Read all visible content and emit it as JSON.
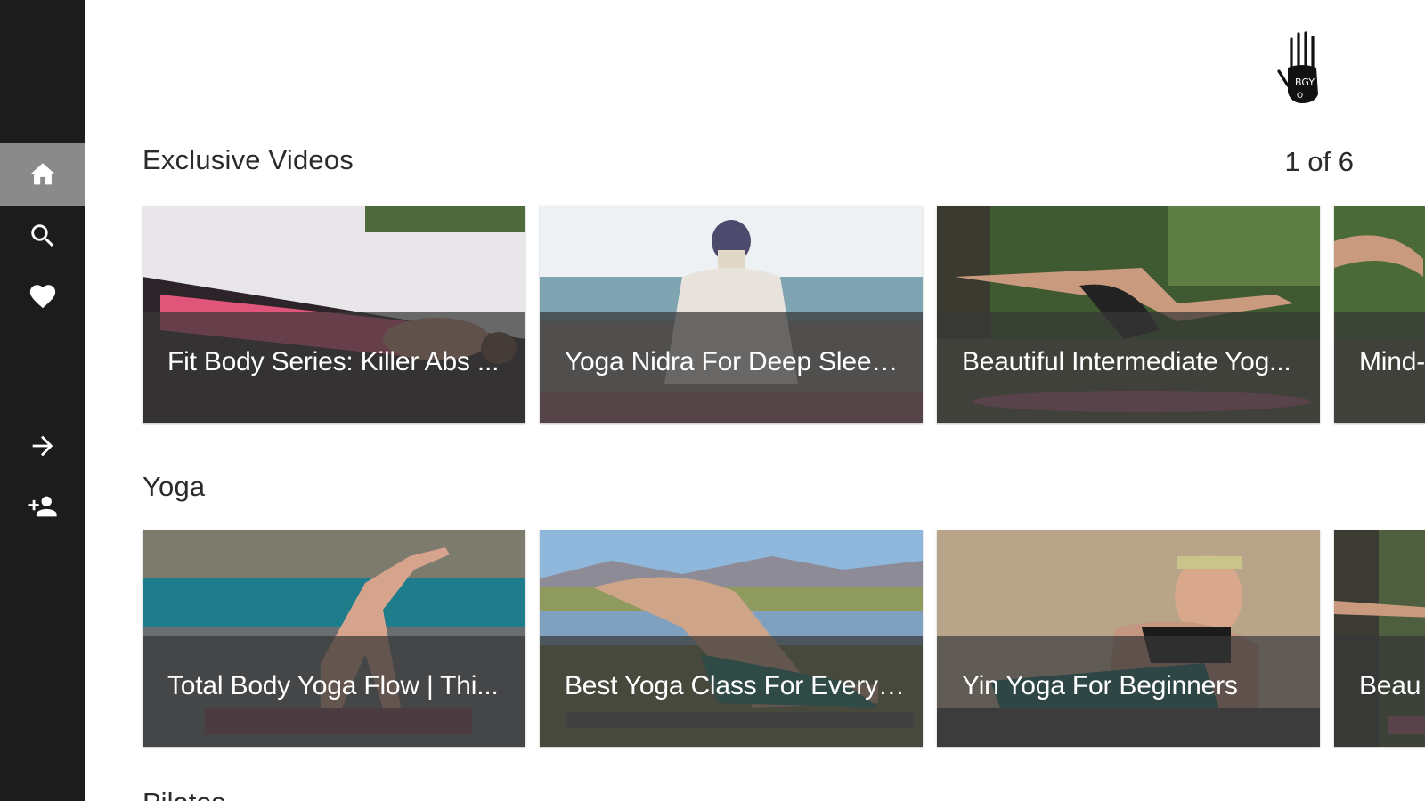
{
  "sidebar": {
    "items": [
      {
        "name": "home",
        "icon": "home-icon",
        "active": true
      },
      {
        "name": "search",
        "icon": "search-icon",
        "active": false
      },
      {
        "name": "favorites",
        "icon": "heart-icon",
        "active": false
      },
      {
        "name": "sign-in",
        "icon": "arrow-right-icon",
        "active": false
      },
      {
        "name": "sign-up",
        "icon": "add-user-icon",
        "active": false
      }
    ]
  },
  "logo": {
    "icon": "hand-logo-icon"
  },
  "sections": [
    {
      "title": "Exclusive Videos",
      "counter": "1 of 6",
      "tiles": [
        {
          "label": "Fit Body Series: Killer Abs ..."
        },
        {
          "label": "Yoga Nidra For Deep Sleep ..."
        },
        {
          "label": "Beautiful Intermediate Yog..."
        },
        {
          "label": "Mind-"
        }
      ]
    },
    {
      "title": "Yoga",
      "tiles": [
        {
          "label": "Total Body Yoga Flow | Thi..."
        },
        {
          "label": "Best Yoga Class For Everyo..."
        },
        {
          "label": "Yin Yoga For Beginners"
        },
        {
          "label": "Beau"
        }
      ]
    }
  ],
  "next_section_title": "Pilates"
}
